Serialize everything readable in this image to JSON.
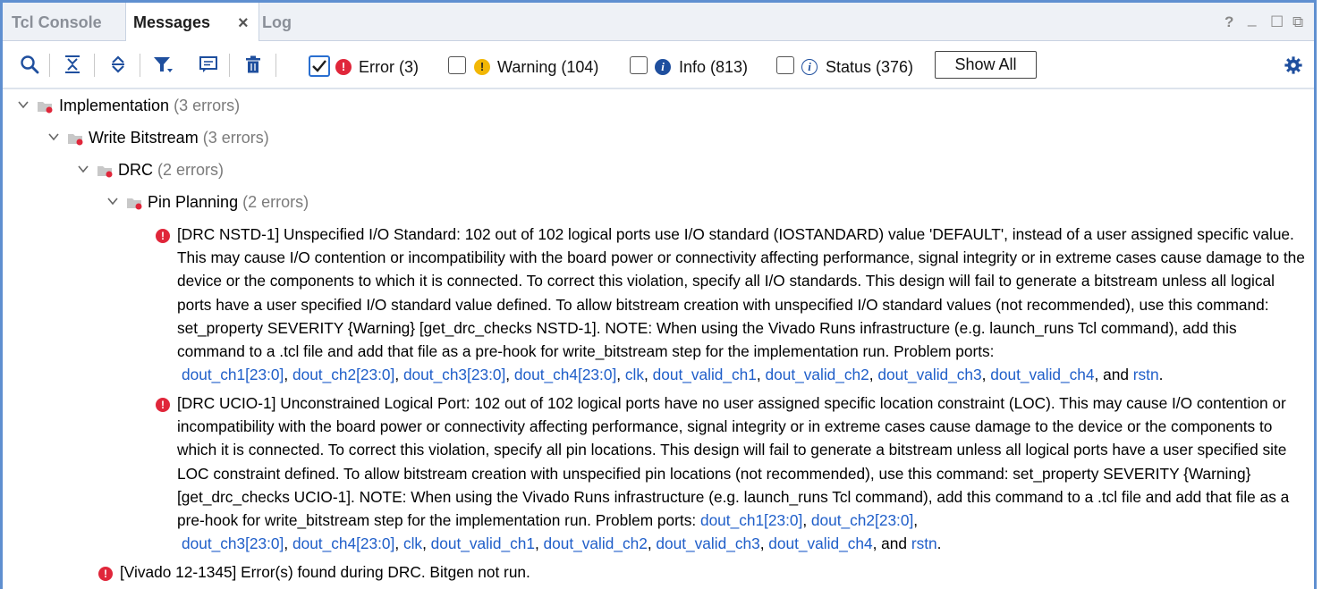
{
  "tabs": [
    {
      "label": "Tcl Console",
      "active": false
    },
    {
      "label": "Messages",
      "active": true
    },
    {
      "label": "Log",
      "active": false
    }
  ],
  "window_controls": {
    "help": "?",
    "minimize": "_",
    "maximize": "☐",
    "restore": "⧉"
  },
  "toolbar": {
    "icons": [
      "search-icon",
      "collapse-all-icon",
      "expand-all-icon",
      "filter-icon",
      "message-icon",
      "delete-icon"
    ],
    "filters": [
      {
        "label": "Error (3)",
        "checked": true,
        "icon": "error-icon",
        "color": "#e0263a"
      },
      {
        "label": "Warning (104)",
        "checked": false,
        "icon": "warning-icon",
        "color": "#f2b705"
      },
      {
        "label": "Info (813)",
        "checked": false,
        "icon": "info-icon",
        "color": "#1f4f9e"
      },
      {
        "label": "Status (376)",
        "checked": false,
        "icon": "status-icon",
        "color": "#1f4f9e"
      }
    ],
    "show_all_label": "Show All"
  },
  "tree": {
    "implementation": {
      "label": "Implementation",
      "count": "(3 errors)"
    },
    "write_bitstream": {
      "label": "Write Bitstream",
      "count": "(3 errors)"
    },
    "drc": {
      "label": "DRC",
      "count": "(2 errors)"
    },
    "pin_planning": {
      "label": "Pin Planning",
      "count": "(2 errors)"
    }
  },
  "messages": {
    "nstd": {
      "text": "[DRC NSTD-1] Unspecified I/O Standard: 102 out of 102 logical ports use I/O standard (IOSTANDARD) value 'DEFAULT', instead of a user assigned specific value. This may cause I/O contention or incompatibility with the board power or connectivity affecting performance, signal integrity or in extreme cases cause damage to the device or the components to which it is connected. To correct this violation, specify all I/O standards. This design will fail to generate a bitstream unless all logical ports have a user specified I/O standard value defined. To allow bitstream creation with unspecified I/O standard values (not recommended), use this command: set_property SEVERITY {Warning} [get_drc_checks NSTD-1]. NOTE: When using the Vivado Runs infrastructure (e.g. launch_runs Tcl command), add this command to a .tcl file and add that file as a pre-hook for write_bitstream step for the implementation run. Problem ports:",
      "ports": [
        "dout_ch1[23:0]",
        "dout_ch2[23:0]",
        "dout_ch3[23:0]",
        "dout_ch4[23:0]",
        "clk",
        "dout_valid_ch1",
        "dout_valid_ch2",
        "dout_valid_ch3",
        "dout_valid_ch4"
      ],
      "last_port": "rstn"
    },
    "ucio": {
      "text": "[DRC UCIO-1] Unconstrained Logical Port: 102 out of 102 logical ports have no user assigned specific location constraint (LOC). This may cause I/O contention or incompatibility with the board power or connectivity affecting performance, signal integrity or in extreme cases cause damage to the device or the components to which it is connected. To correct this violation, specify all pin locations. This design will fail to generate a bitstream unless all logical ports have a user specified site LOC constraint defined. To allow bitstream creation with unspecified pin locations (not recommended), use this command: set_property SEVERITY {Warning} [get_drc_checks UCIO-1]. NOTE: When using the Vivado Runs infrastructure (e.g. launch_runs Tcl command), add this command to a .tcl file and add that file as a pre-hook for write_bitstream step for the implementation run. Problem ports:",
      "ports": [
        "dout_ch1[23:0]",
        "dout_ch2[23:0]",
        "dout_ch3[23:0]",
        "dout_ch4[23:0]",
        "clk",
        "dout_valid_ch1",
        "dout_valid_ch2",
        "dout_valid_ch3",
        "dout_valid_ch4"
      ],
      "last_port": "rstn"
    },
    "vivado": {
      "text": "[Vivado 12-1345] Error(s) found during DRC. Bitgen not run."
    }
  },
  "conjunction": "and"
}
